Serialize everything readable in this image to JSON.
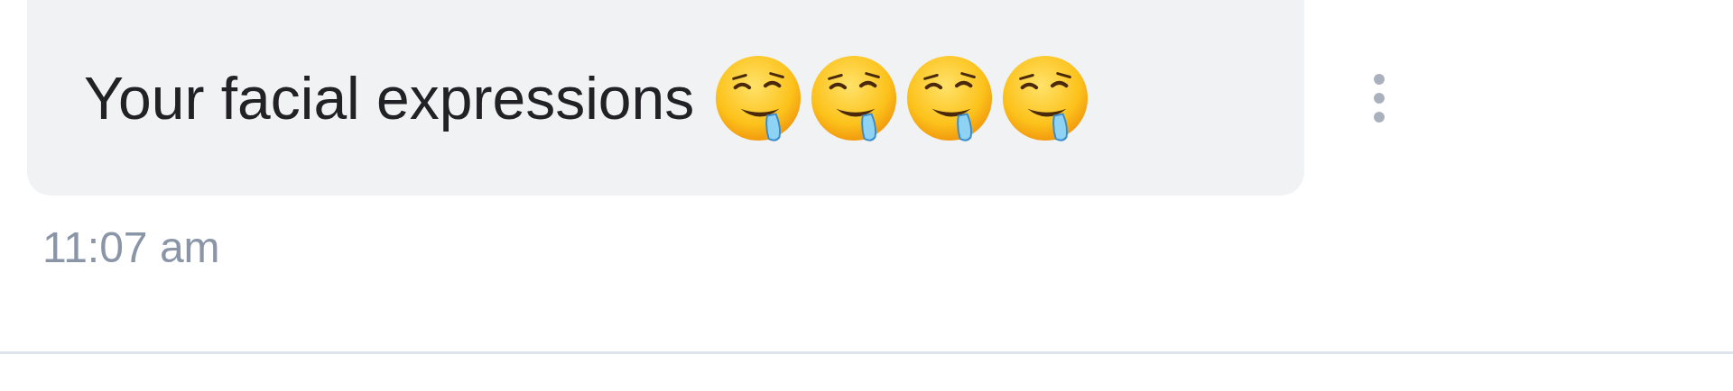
{
  "message": {
    "text": "Your facial expressions",
    "emojis": [
      {
        "kind": "drooling-face"
      },
      {
        "kind": "drooling-face"
      },
      {
        "kind": "drooling-face"
      },
      {
        "kind": "drooling-face"
      }
    ],
    "time": "11:07 am"
  },
  "menu": {
    "kind": "more-vertical"
  }
}
